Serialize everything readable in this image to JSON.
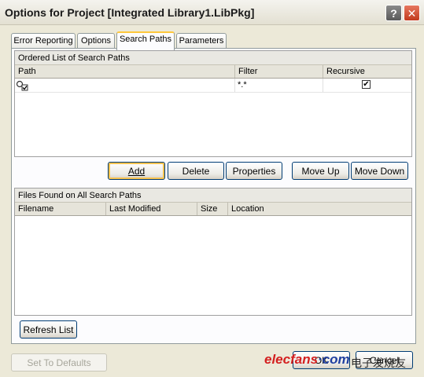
{
  "window": {
    "title": "Options for Project [Integrated Library1.LibPkg]",
    "help_label": "?",
    "close_label": "✕"
  },
  "tabs": [
    {
      "label": "Error Reporting",
      "active": false
    },
    {
      "label": "Options",
      "active": false
    },
    {
      "label": "Search Paths",
      "active": true
    },
    {
      "label": "Parameters",
      "active": false
    }
  ],
  "search_paths": {
    "group_title": "Ordered List of Search Paths",
    "columns": [
      "Path",
      "Filter",
      "Recursive"
    ],
    "rows": [
      {
        "path": "",
        "filter": "*.*",
        "recursive": "✔"
      }
    ]
  },
  "path_buttons": {
    "add": "Add",
    "delete": "Delete",
    "properties": "Properties",
    "move_up": "Move Up",
    "move_down": "Move Down"
  },
  "files_found": {
    "group_title": "Files Found on All Search Paths",
    "columns": [
      "Filename",
      "Last Modified",
      "Size",
      "Location"
    ]
  },
  "refresh_button": "Refresh List",
  "footer": {
    "set_defaults": "Set To Defaults",
    "ok": "OK",
    "cancel": "Cancel"
  },
  "watermark": {
    "brand": "elecfans",
    "domain": "·com",
    "cn": "电子发烧友"
  }
}
